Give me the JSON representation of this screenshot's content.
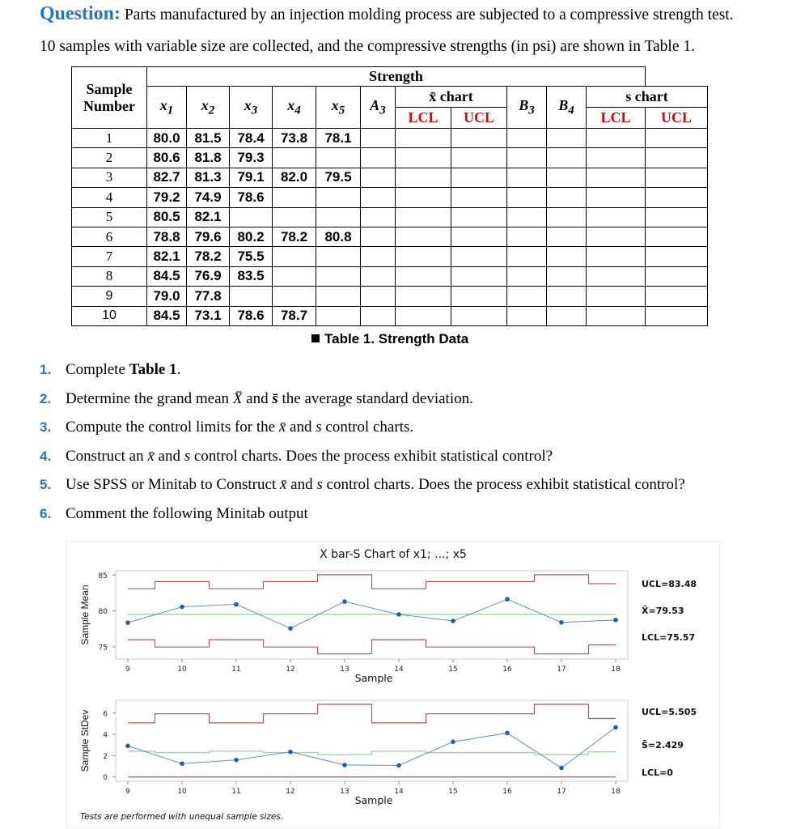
{
  "question": {
    "label": "Question:",
    "line1": "Parts manufactured by an injection molding process are subjected to a compressive strength test.",
    "line2": "10 samples with variable size are collected, and the compressive strengths (in psi) are shown in Table 1."
  },
  "table": {
    "header_group": "Strength",
    "sample_number_label": "Sample Number",
    "columns": [
      "x1",
      "x2",
      "x3",
      "x4",
      "x5",
      "A3",
      "x̄ chart",
      "B3",
      "B4",
      "s chart"
    ],
    "xbar_chart_label": "x̄ chart",
    "s_chart_label": "s chart",
    "lcl": "LCL",
    "ucl": "UCL",
    "rows": [
      {
        "n": "1",
        "x": [
          "80.0",
          "81.5",
          "78.4",
          "73.8",
          "78.1"
        ]
      },
      {
        "n": "2",
        "x": [
          "80.6",
          "81.8",
          "79.3",
          "",
          ""
        ]
      },
      {
        "n": "3",
        "x": [
          "82.7",
          "81.3",
          "79.1",
          "82.0",
          "79.5"
        ]
      },
      {
        "n": "4",
        "x": [
          "79.2",
          "74.9",
          "78.6",
          "",
          ""
        ]
      },
      {
        "n": "5",
        "x": [
          "80.5",
          "82.1",
          "",
          "",
          ""
        ]
      },
      {
        "n": "6",
        "x": [
          "78.8",
          "79.6",
          "80.2",
          "78.2",
          "80.8"
        ]
      },
      {
        "n": "7",
        "x": [
          "82.1",
          "78.2",
          "75.5",
          "",
          ""
        ]
      },
      {
        "n": "8",
        "x": [
          "84.5",
          "76.9",
          "83.5",
          "",
          ""
        ]
      },
      {
        "n": "9",
        "x": [
          "79.0",
          "77.8",
          "",
          "",
          ""
        ]
      },
      {
        "n": "10",
        "x": [
          "84.5",
          "73.1",
          "78.6",
          "78.7",
          ""
        ]
      }
    ],
    "caption": "Table 1. Strength Data"
  },
  "tasks": [
    {
      "num": "1.",
      "text": "Complete",
      "bold": "Table 1",
      "after": "."
    },
    {
      "num": "2.",
      "pre": "Determine the grand mean ",
      "sym1": "X̄̄",
      "mid": " and ",
      "sym2": "s̄",
      "post": " the average standard deviation."
    },
    {
      "num": "3.",
      "pre": "Compute the control limits for the ",
      "sym1": "x̄",
      "mid": " and ",
      "sym2": "s",
      "post": " control charts."
    },
    {
      "num": "4.",
      "pre": "Construct an  ",
      "sym1": "x̄",
      "mid": " and ",
      "sym2": "s",
      "post": " control charts. Does the process exhibit statistical control?"
    },
    {
      "num": "5.",
      "pre": "Use SPSS or Minitab to Construct ",
      "sym1": "x̄",
      "mid": " and ",
      "sym2": "s",
      "post": " control charts.  Does the process exhibit statistical control?"
    },
    {
      "num": "6.",
      "text": "Comment the following Minitab output"
    }
  ],
  "chart_data": [
    {
      "type": "line",
      "title": "X bar-S Chart of x1; ...; x5",
      "xlabel": "Sample",
      "ylabel": "Sample Mean",
      "x": [
        9,
        10,
        11,
        12,
        13,
        14,
        15,
        16,
        17,
        18
      ],
      "xticks": [
        "9",
        "10",
        "11",
        "12",
        "13",
        "14",
        "15",
        "16",
        "17",
        "18"
      ],
      "yticks": [
        "75",
        "80",
        "85"
      ],
      "ylim": [
        73.3,
        85.6
      ],
      "series": [
        {
          "name": "Sample Mean",
          "values": [
            78.36,
            80.57,
            80.92,
            77.57,
            81.3,
            79.52,
            78.6,
            81.63,
            78.4,
            78.73
          ],
          "color": "#1f5fa8"
        }
      ],
      "ucl_steps": [
        83.08,
        84.09,
        83.08,
        84.09,
        85.05,
        83.08,
        84.09,
        84.09,
        85.05,
        83.8
      ],
      "lcl_steps": [
        75.98,
        74.97,
        75.98,
        74.97,
        74.01,
        75.98,
        74.97,
        74.97,
        74.01,
        75.27
      ],
      "center": 79.53,
      "labels": {
        "ucl": "UCL=83.48",
        "center": "X̄̄=79.53",
        "lcl": "LCL=75.57"
      },
      "colors": {
        "limit": "#b85454",
        "center": "#9fd49f",
        "points": "#1f5fa8"
      }
    },
    {
      "type": "line",
      "xlabel": "Sample",
      "ylabel": "Sample StDev",
      "x": [
        9,
        10,
        11,
        12,
        13,
        14,
        15,
        16,
        17,
        18
      ],
      "xticks": [
        "9",
        "10",
        "11",
        "12",
        "13",
        "14",
        "15",
        "16",
        "17",
        "18"
      ],
      "yticks": [
        "0",
        "2",
        "4",
        "6"
      ],
      "ylim": [
        -0.4,
        7.2
      ],
      "series": [
        {
          "name": "Sample StDev",
          "values": [
            2.92,
            1.25,
            1.6,
            2.36,
            1.13,
            1.09,
            3.3,
            4.13,
            0.85,
            4.66
          ],
          "color": "#1f5fa8"
        }
      ],
      "ucl_steps": [
        5.08,
        5.93,
        5.08,
        5.93,
        6.82,
        5.08,
        5.93,
        5.93,
        6.82,
        5.49
      ],
      "center_steps": [
        2.43,
        2.29,
        2.43,
        2.29,
        2.11,
        2.43,
        2.29,
        2.29,
        2.11,
        2.36
      ],
      "lcl": 0,
      "labels": {
        "ucl": "UCL=5.505",
        "center": "S̄=2.429",
        "lcl": "LCL=0"
      },
      "colors": {
        "limit": "#b85454",
        "center": "#9fd49f",
        "points": "#1f5fa8"
      }
    }
  ],
  "chart_note": "Tests are performed with unequal sample sizes."
}
